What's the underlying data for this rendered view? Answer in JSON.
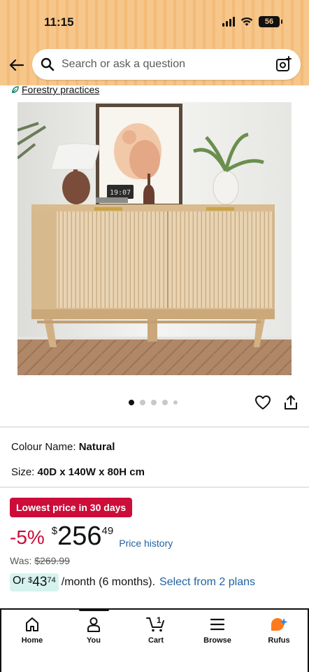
{
  "status_bar": {
    "time": "11:15",
    "battery": "56"
  },
  "header": {
    "search_placeholder": "Search or ask a question"
  },
  "badges": {
    "forestry_label": "Forestry practices"
  },
  "product_image": {
    "clock_text": "19:07"
  },
  "carousel": {
    "total": 5,
    "active_index": 0
  },
  "specs": {
    "colour_label": "Colour Name:",
    "colour_value": "Natural",
    "size_label": "Size:",
    "size_value": "40D x 140W x 80H cm"
  },
  "price": {
    "deal_badge": "Lowest price in 30 days",
    "discount": "-5%",
    "currency": "$",
    "whole": "256",
    "fraction": "49",
    "history_link": "Price history",
    "was_label": "Was:",
    "was_value": "$269.99"
  },
  "installment": {
    "prefix": "Or",
    "currency": "$",
    "whole": "43",
    "fraction": "74",
    "suffix": "/month (6 months).",
    "plans_link": "Select from 2 plans"
  },
  "nav": {
    "items": [
      {
        "label": "Home",
        "icon": "home-icon"
      },
      {
        "label": "You",
        "icon": "user-icon"
      },
      {
        "label": "Cart",
        "icon": "cart-icon",
        "count": "1"
      },
      {
        "label": "Browse",
        "icon": "menu-icon"
      },
      {
        "label": "Rufus",
        "icon": "rufus-icon"
      }
    ]
  },
  "colors": {
    "header_bg": "#f6c68a",
    "deal_red": "#cc0c39",
    "link_blue": "#2162a1",
    "installment_bg": "#d6f2ef"
  }
}
